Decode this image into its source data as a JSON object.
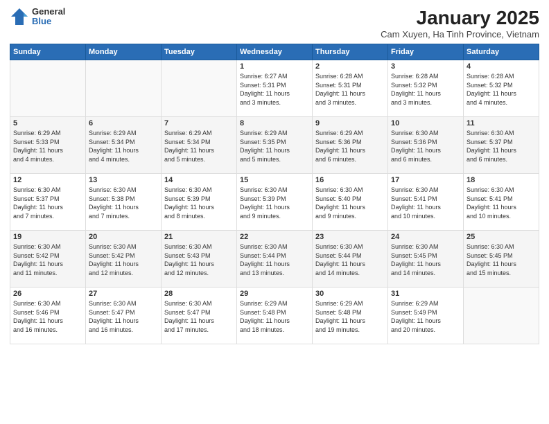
{
  "header": {
    "logo_general": "General",
    "logo_blue": "Blue",
    "title": "January 2025",
    "subtitle": "Cam Xuyen, Ha Tinh Province, Vietnam"
  },
  "weekdays": [
    "Sunday",
    "Monday",
    "Tuesday",
    "Wednesday",
    "Thursday",
    "Friday",
    "Saturday"
  ],
  "weeks": [
    [
      {
        "day": "",
        "info": ""
      },
      {
        "day": "",
        "info": ""
      },
      {
        "day": "",
        "info": ""
      },
      {
        "day": "1",
        "info": "Sunrise: 6:27 AM\nSunset: 5:31 PM\nDaylight: 11 hours\nand 3 minutes."
      },
      {
        "day": "2",
        "info": "Sunrise: 6:28 AM\nSunset: 5:31 PM\nDaylight: 11 hours\nand 3 minutes."
      },
      {
        "day": "3",
        "info": "Sunrise: 6:28 AM\nSunset: 5:32 PM\nDaylight: 11 hours\nand 3 minutes."
      },
      {
        "day": "4",
        "info": "Sunrise: 6:28 AM\nSunset: 5:32 PM\nDaylight: 11 hours\nand 4 minutes."
      }
    ],
    [
      {
        "day": "5",
        "info": "Sunrise: 6:29 AM\nSunset: 5:33 PM\nDaylight: 11 hours\nand 4 minutes."
      },
      {
        "day": "6",
        "info": "Sunrise: 6:29 AM\nSunset: 5:34 PM\nDaylight: 11 hours\nand 4 minutes."
      },
      {
        "day": "7",
        "info": "Sunrise: 6:29 AM\nSunset: 5:34 PM\nDaylight: 11 hours\nand 5 minutes."
      },
      {
        "day": "8",
        "info": "Sunrise: 6:29 AM\nSunset: 5:35 PM\nDaylight: 11 hours\nand 5 minutes."
      },
      {
        "day": "9",
        "info": "Sunrise: 6:29 AM\nSunset: 5:36 PM\nDaylight: 11 hours\nand 6 minutes."
      },
      {
        "day": "10",
        "info": "Sunrise: 6:30 AM\nSunset: 5:36 PM\nDaylight: 11 hours\nand 6 minutes."
      },
      {
        "day": "11",
        "info": "Sunrise: 6:30 AM\nSunset: 5:37 PM\nDaylight: 11 hours\nand 6 minutes."
      }
    ],
    [
      {
        "day": "12",
        "info": "Sunrise: 6:30 AM\nSunset: 5:37 PM\nDaylight: 11 hours\nand 7 minutes."
      },
      {
        "day": "13",
        "info": "Sunrise: 6:30 AM\nSunset: 5:38 PM\nDaylight: 11 hours\nand 7 minutes."
      },
      {
        "day": "14",
        "info": "Sunrise: 6:30 AM\nSunset: 5:39 PM\nDaylight: 11 hours\nand 8 minutes."
      },
      {
        "day": "15",
        "info": "Sunrise: 6:30 AM\nSunset: 5:39 PM\nDaylight: 11 hours\nand 9 minutes."
      },
      {
        "day": "16",
        "info": "Sunrise: 6:30 AM\nSunset: 5:40 PM\nDaylight: 11 hours\nand 9 minutes."
      },
      {
        "day": "17",
        "info": "Sunrise: 6:30 AM\nSunset: 5:41 PM\nDaylight: 11 hours\nand 10 minutes."
      },
      {
        "day": "18",
        "info": "Sunrise: 6:30 AM\nSunset: 5:41 PM\nDaylight: 11 hours\nand 10 minutes."
      }
    ],
    [
      {
        "day": "19",
        "info": "Sunrise: 6:30 AM\nSunset: 5:42 PM\nDaylight: 11 hours\nand 11 minutes."
      },
      {
        "day": "20",
        "info": "Sunrise: 6:30 AM\nSunset: 5:42 PM\nDaylight: 11 hours\nand 12 minutes."
      },
      {
        "day": "21",
        "info": "Sunrise: 6:30 AM\nSunset: 5:43 PM\nDaylight: 11 hours\nand 12 minutes."
      },
      {
        "day": "22",
        "info": "Sunrise: 6:30 AM\nSunset: 5:44 PM\nDaylight: 11 hours\nand 13 minutes."
      },
      {
        "day": "23",
        "info": "Sunrise: 6:30 AM\nSunset: 5:44 PM\nDaylight: 11 hours\nand 14 minutes."
      },
      {
        "day": "24",
        "info": "Sunrise: 6:30 AM\nSunset: 5:45 PM\nDaylight: 11 hours\nand 14 minutes."
      },
      {
        "day": "25",
        "info": "Sunrise: 6:30 AM\nSunset: 5:45 PM\nDaylight: 11 hours\nand 15 minutes."
      }
    ],
    [
      {
        "day": "26",
        "info": "Sunrise: 6:30 AM\nSunset: 5:46 PM\nDaylight: 11 hours\nand 16 minutes."
      },
      {
        "day": "27",
        "info": "Sunrise: 6:30 AM\nSunset: 5:47 PM\nDaylight: 11 hours\nand 16 minutes."
      },
      {
        "day": "28",
        "info": "Sunrise: 6:30 AM\nSunset: 5:47 PM\nDaylight: 11 hours\nand 17 minutes."
      },
      {
        "day": "29",
        "info": "Sunrise: 6:29 AM\nSunset: 5:48 PM\nDaylight: 11 hours\nand 18 minutes."
      },
      {
        "day": "30",
        "info": "Sunrise: 6:29 AM\nSunset: 5:48 PM\nDaylight: 11 hours\nand 19 minutes."
      },
      {
        "day": "31",
        "info": "Sunrise: 6:29 AM\nSunset: 5:49 PM\nDaylight: 11 hours\nand 20 minutes."
      },
      {
        "day": "",
        "info": ""
      }
    ]
  ]
}
